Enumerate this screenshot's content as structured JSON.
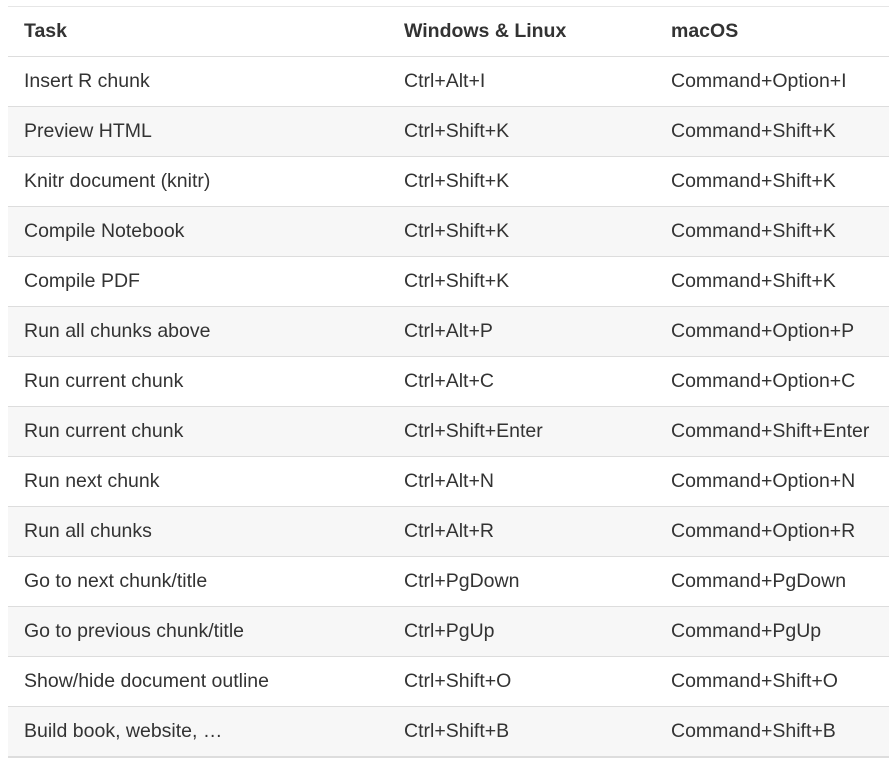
{
  "table": {
    "headers": [
      "Task",
      "Windows & Linux",
      "macOS"
    ],
    "rows": [
      [
        "Insert R chunk",
        "Ctrl+Alt+I",
        "Command+Option+I"
      ],
      [
        "Preview HTML",
        "Ctrl+Shift+K",
        "Command+Shift+K"
      ],
      [
        "Knitr document (knitr)",
        "Ctrl+Shift+K",
        "Command+Shift+K"
      ],
      [
        "Compile Notebook",
        "Ctrl+Shift+K",
        "Command+Shift+K"
      ],
      [
        "Compile PDF",
        "Ctrl+Shift+K",
        "Command+Shift+K"
      ],
      [
        "Run all chunks above",
        "Ctrl+Alt+P",
        "Command+Option+P"
      ],
      [
        "Run current chunk",
        "Ctrl+Alt+C",
        "Command+Option+C"
      ],
      [
        "Run current chunk",
        "Ctrl+Shift+Enter",
        "Command+Shift+Enter"
      ],
      [
        "Run next chunk",
        "Ctrl+Alt+N",
        "Command+Option+N"
      ],
      [
        "Run all chunks",
        "Ctrl+Alt+R",
        "Command+Option+R"
      ],
      [
        "Go to next chunk/title",
        "Ctrl+PgDown",
        "Command+PgDown"
      ],
      [
        "Go to previous chunk/title",
        "Ctrl+PgUp",
        "Command+PgUp"
      ],
      [
        "Show/hide document outline",
        "Ctrl+Shift+O",
        "Command+Shift+O"
      ],
      [
        "Build book, website, …",
        "Ctrl+Shift+B",
        "Command+Shift+B"
      ]
    ]
  }
}
